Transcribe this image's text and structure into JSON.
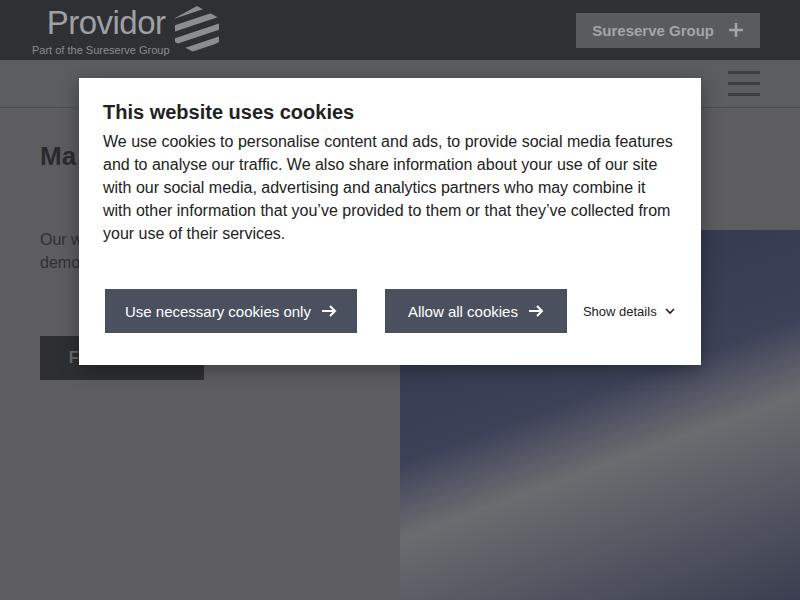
{
  "header": {
    "logo": "Providor",
    "tagline": "Part of the Sureserve Group",
    "group_button": "Sureserve Group"
  },
  "hero": {
    "heading": "Ma",
    "text_lines": [
      "Our w",
      "demo"
    ],
    "button": "Find out more"
  },
  "cookie_dialog": {
    "title": "This website uses cookies",
    "body": "We use cookies to personalise content and ads, to provide social media features and to analyse our traffic. We also share information about your use of our site with our social media, advertising and analytics partners who may combine it with other information that you’ve provided to them or that they’ve collected from your use of their services.",
    "buttons": [
      "Use necessary cookies only",
      "Allow all cookies"
    ],
    "details_link": {
      "label": "Show details",
      "expanded": false
    }
  }
}
